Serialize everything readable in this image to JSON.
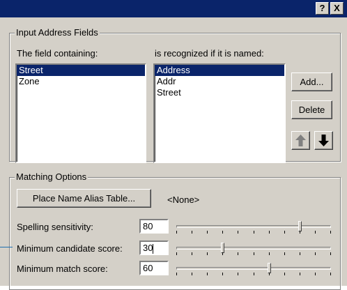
{
  "title_bar": {
    "help_label": "?",
    "close_label": "X"
  },
  "input_address_fields": {
    "group_label": "Input Address Fields",
    "field_list_label": "The field containing:",
    "alias_list_label": "is recognized if it is named:",
    "fields": [
      {
        "label": "Street",
        "selected": true
      },
      {
        "label": "Zone",
        "selected": false
      }
    ],
    "aliases": [
      {
        "label": "Address",
        "selected": true
      },
      {
        "label": "Addr",
        "selected": false
      },
      {
        "label": "Street",
        "selected": false
      }
    ],
    "add_button": "Add...",
    "delete_button": "Delete",
    "move_up_icon": "arrow-up-icon",
    "move_down_icon": "arrow-down-icon"
  },
  "matching_options": {
    "group_label": "Matching Options",
    "alias_table_button": "Place Name Alias Table...",
    "alias_table_value": "<None>",
    "spelling_sensitivity": {
      "label": "Spelling sensitivity:",
      "value": "80",
      "level_percent": 80
    },
    "min_candidate_score": {
      "label": "Minimum candidate score:",
      "value": "30",
      "level_percent": 30
    },
    "min_match_score": {
      "label": "Minimum match score:",
      "value": "60",
      "level_percent": 60
    }
  }
}
